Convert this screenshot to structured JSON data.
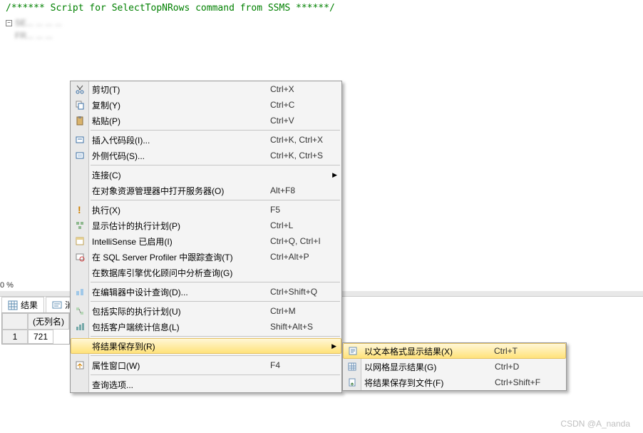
{
  "editor": {
    "comment": "/****** Script for SelectTopNRows command from SSMS  ******/"
  },
  "percent": "0 %",
  "tabs": {
    "results": "结果",
    "messages": "消息"
  },
  "grid": {
    "col_header": "(无列名)",
    "row_num": "1",
    "value": "721"
  },
  "mainMenu": [
    {
      "label": "剪切(T)",
      "shortcut": "Ctrl+X",
      "icon": "cut-icon"
    },
    {
      "label": "复制(Y)",
      "shortcut": "Ctrl+C",
      "icon": "copy-icon"
    },
    {
      "label": "粘贴(P)",
      "shortcut": "Ctrl+V",
      "icon": "paste-icon"
    },
    {
      "sep": true
    },
    {
      "label": "插入代码段(I)...",
      "shortcut": "Ctrl+K, Ctrl+X",
      "icon": "snippet-icon"
    },
    {
      "label": "外侧代码(S)...",
      "shortcut": "Ctrl+K, Ctrl+S",
      "icon": "surround-icon"
    },
    {
      "sep": true
    },
    {
      "label": "连接(C)",
      "shortcut": "",
      "arrow": true
    },
    {
      "label": "在对象资源管理器中打开服务器(O)",
      "shortcut": "Alt+F8"
    },
    {
      "sep": true
    },
    {
      "label": "执行(X)",
      "shortcut": "F5",
      "icon": "execute-icon"
    },
    {
      "label": "显示估计的执行计划(P)",
      "shortcut": "Ctrl+L",
      "icon": "plan-icon"
    },
    {
      "label": "IntelliSense 已启用(I)",
      "shortcut": "Ctrl+Q, Ctrl+I",
      "icon": "intellisense-icon"
    },
    {
      "label": "在 SQL Server Profiler 中跟踪查询(T)",
      "shortcut": "Ctrl+Alt+P",
      "icon": "profiler-icon"
    },
    {
      "label": "在数据库引擎优化顾问中分析查询(G)",
      "shortcut": ""
    },
    {
      "sep": true
    },
    {
      "label": "在编辑器中设计查询(D)...",
      "shortcut": "Ctrl+Shift+Q",
      "icon": "design-icon"
    },
    {
      "sep": true
    },
    {
      "label": "包括实际的执行计划(U)",
      "shortcut": "Ctrl+M",
      "icon": "actualplan-icon"
    },
    {
      "label": "包括客户端统计信息(L)",
      "shortcut": "Shift+Alt+S",
      "icon": "stats-icon"
    },
    {
      "sep": true
    },
    {
      "label": "将结果保存到(R)",
      "shortcut": "",
      "arrow": true,
      "hover": true
    },
    {
      "sep": true
    },
    {
      "label": "属性窗口(W)",
      "shortcut": "F4",
      "icon": "properties-icon"
    },
    {
      "sep": true
    },
    {
      "label": "查询选项...",
      "shortcut": ""
    }
  ],
  "subMenu": [
    {
      "label": "以文本格式显示结果(X)",
      "shortcut": "Ctrl+T",
      "icon": "text-result-icon",
      "hover": true
    },
    {
      "label": "以网格显示结果(G)",
      "shortcut": "Ctrl+D",
      "icon": "grid-result-icon"
    },
    {
      "label": "将结果保存到文件(F)",
      "shortcut": "Ctrl+Shift+F",
      "icon": "file-result-icon"
    }
  ],
  "watermark": "CSDN @A_nanda"
}
